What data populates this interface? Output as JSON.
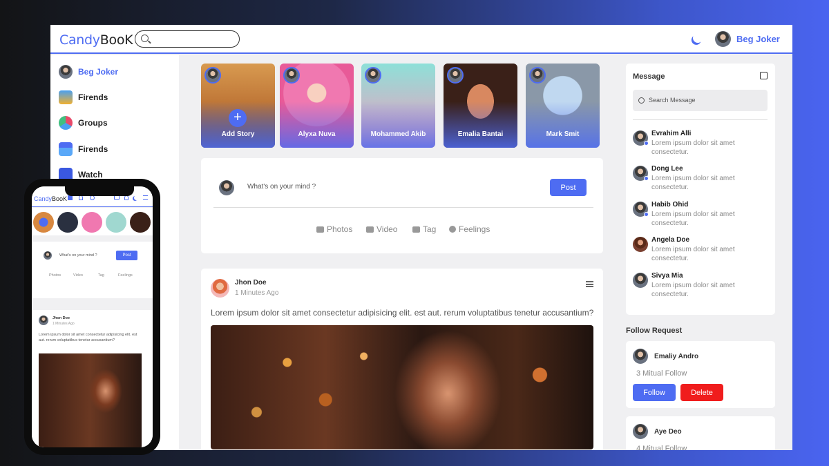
{
  "colors": {
    "accent": "#4e6cf2",
    "danger": "#f01d1d"
  },
  "topbar": {
    "logo_main": "Candy",
    "logo_tail": "BooK",
    "user_name": "Beg Joker"
  },
  "sidebar": {
    "items": [
      {
        "label": "Beg Joker",
        "icon": "user-avatar"
      },
      {
        "label": "Firends",
        "icon": "friends-icon"
      },
      {
        "label": "Groups",
        "icon": "groups-icon"
      },
      {
        "label": "Firends",
        "icon": "store-icon"
      },
      {
        "label": "Watch",
        "icon": "watch-icon"
      }
    ]
  },
  "stories": [
    {
      "label": "Add Story"
    },
    {
      "label": "Alyxa Nuva"
    },
    {
      "label": "Mohammed Akib"
    },
    {
      "label": "Emalia Bantai"
    },
    {
      "label": "Mark Smit"
    }
  ],
  "composer": {
    "placeholder": "What's on your mind ?",
    "post_label": "Post",
    "actions": [
      "Photos",
      "Video",
      "Tag",
      "Feelings"
    ]
  },
  "feed_post": {
    "author": "Jhon Doe",
    "time": "1 Minutes Ago",
    "text": "Lorem ipsum dolor sit amet consectetur adipisicing elit. est aut. rerum voluptatibus tenetur accusantium?"
  },
  "messages": {
    "title": "Message",
    "search_placeholder": "Search Message",
    "items": [
      {
        "name": "Evrahim Alli",
        "text": "Lorem ipsum dolor sit amet consectetur."
      },
      {
        "name": "Dong Lee",
        "text": "Lorem ipsum dolor sit amet consectetur."
      },
      {
        "name": "Habib Ohid",
        "text": "Lorem ipsum dolor sit amet consectetur."
      },
      {
        "name": "Angela Doe",
        "text": "Lorem ipsum dolor sit amet consectetur."
      },
      {
        "name": "Sivya Mia",
        "text": "Lorem ipsum dolor sit amet consectetur."
      }
    ]
  },
  "follow_requests": {
    "title": "Follow Request",
    "items": [
      {
        "name": "Emaliy Andro",
        "mutual": "3 Mitual Follow",
        "follow_label": "Follow",
        "delete_label": "Delete"
      },
      {
        "name": "Aye Deo",
        "mutual": "4 Mitual Follow"
      }
    ]
  },
  "mobile": {
    "logo_main": "Candy",
    "logo_tail": "BooK",
    "placeholder": "What's on your mind ?",
    "post_label": "Post",
    "actions": [
      "Photos",
      "Video",
      "Tag",
      "Feelings"
    ],
    "post_author": "Jhon Doe",
    "post_time": "1 Minutes Ago",
    "post_text": "Lorem ipsum dolor sit amet consectetur adipisicing elit. est aut. rerum voluptatibus tenetur accusantium?"
  }
}
